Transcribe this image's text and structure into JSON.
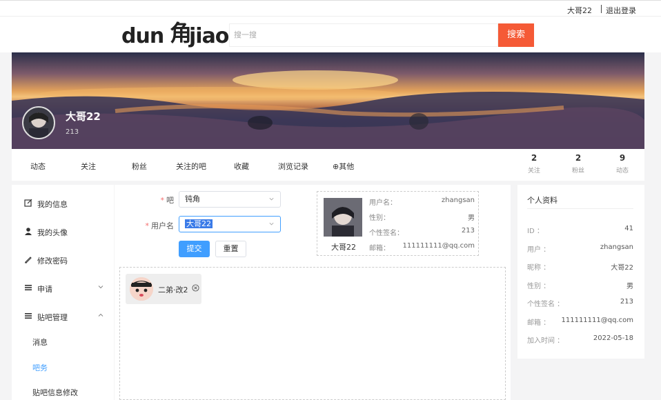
{
  "topbar": {
    "username": "大哥22",
    "logout": "退出登录"
  },
  "logo": {
    "left_text": "dun",
    "glyph": "角",
    "right_text": "jiao"
  },
  "search": {
    "placeholder": "搜一搜",
    "button": "搜索"
  },
  "banner": {
    "name": "大哥22",
    "sub": "213"
  },
  "tabs": [
    "动态",
    "关注",
    "粉丝",
    "关注的吧",
    "收藏",
    "浏览记录",
    "⊕其他"
  ],
  "stats": [
    {
      "num": "2",
      "label": "关注"
    },
    {
      "num": "2",
      "label": "粉丝"
    },
    {
      "num": "9",
      "label": "动态"
    }
  ],
  "sidebar": {
    "items": [
      {
        "label": "我的信息",
        "icon": "edit-icon"
      },
      {
        "label": "我的头像",
        "icon": "user-icon"
      },
      {
        "label": "修改密码",
        "icon": "pencil-icon"
      },
      {
        "label": "申请",
        "icon": "menu-icon"
      },
      {
        "label": "贴吧管理",
        "icon": "menu-icon"
      }
    ],
    "subitems": [
      "消息",
      "吧务",
      "贴吧信息修改"
    ]
  },
  "form": {
    "bar_label": "吧",
    "bar_value": "钝角",
    "user_label": "用户名",
    "user_value": "大哥22",
    "submit": "提交",
    "reset": "重置"
  },
  "infocard": {
    "name": "大哥22",
    "rows": [
      {
        "k": "用户名：",
        "v": "zhangsan"
      },
      {
        "k": "性别：",
        "v": "男"
      },
      {
        "k": "个性签名：",
        "v": "213"
      },
      {
        "k": "邮箱：",
        "v": "111111111@qq.com"
      }
    ]
  },
  "chip": {
    "name": "二弟·改2"
  },
  "profile": {
    "title": "个人资料",
    "rows": [
      {
        "k": "ID ：",
        "v": "41"
      },
      {
        "k": "用户 ：",
        "v": "zhangsan"
      },
      {
        "k": "昵称 ：",
        "v": "大哥22"
      },
      {
        "k": "性别 ：",
        "v": "男"
      },
      {
        "k": "个性签名 ：",
        "v": "213"
      },
      {
        "k": "邮箱 ：",
        "v": "111111111@qq.com"
      },
      {
        "k": "加入时间 ：",
        "v": "2022-05-18"
      }
    ]
  }
}
